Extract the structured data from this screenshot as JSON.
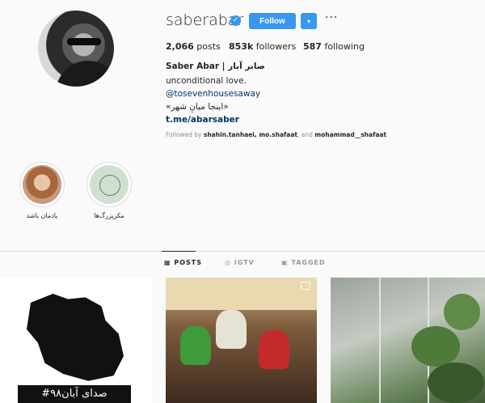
{
  "profile": {
    "username": "saberabar",
    "follow_label": "Follow",
    "dropdown_label": "▾",
    "more_label": "···",
    "posts_count": "2,066",
    "posts_label": "posts",
    "followers_count": "853k",
    "followers_label": "followers",
    "following_count": "587",
    "following_label": "following"
  },
  "bio": {
    "name": "Saber Abar | صابر آبار",
    "line1": "unconditional love.",
    "tag": "@tosevenhousesaway",
    "line_fa": "«اینجا میانِ شهر»",
    "link": "t.me/abarsaber",
    "followed_prefix": "Followed by",
    "followed_names": "shahin.tanhaei, mo.shafaat",
    "followed_and": ", and",
    "followed_last": "mohammad__shafaat"
  },
  "highlights": [
    {
      "label": "یادمان باشد"
    },
    {
      "label": "مکرپزرگ‌ها"
    }
  ],
  "tabs": {
    "posts": "POSTS",
    "igtv": "IGTV",
    "tagged": "TAGGED"
  },
  "posts": [
    {
      "caption": "#صدای آبان۹۸"
    },
    {
      "caption": ""
    },
    {
      "caption": ""
    }
  ],
  "colors": {
    "accent": "#3897f0",
    "link": "#003569",
    "muted": "#8e8e8e",
    "text": "#262626"
  },
  "icons": {
    "verified": "verified-badge-icon",
    "posts_tab": "grid-icon",
    "igtv_tab": "tv-icon",
    "tagged_tab": "tag-icon",
    "camera": "camera-icon"
  }
}
